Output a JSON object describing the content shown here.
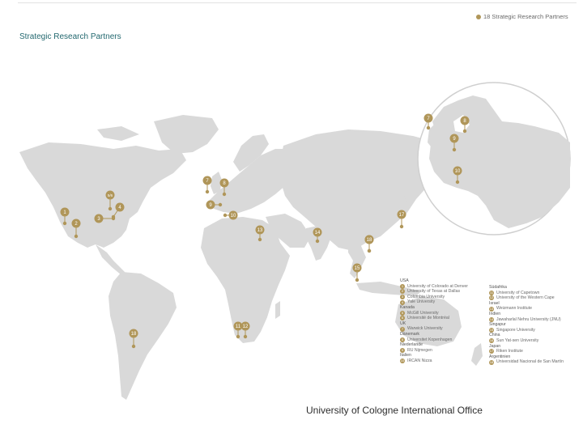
{
  "header": {
    "title": "Strategic Research Partners",
    "legend": "18 Strategic Research Partners"
  },
  "colors": {
    "land": "#d9d9d9",
    "marker": "#b09659",
    "title": "#23686f",
    "inset_border": "#cfcfcf"
  },
  "markers": [
    {
      "label": "1"
    },
    {
      "label": "2"
    },
    {
      "label": "3"
    },
    {
      "label": "4"
    },
    {
      "label": "5/6"
    },
    {
      "label": "7"
    },
    {
      "label": "8"
    },
    {
      "label": "9"
    },
    {
      "label": "10"
    },
    {
      "label": "11"
    },
    {
      "label": "12"
    },
    {
      "label": "13"
    },
    {
      "label": "14"
    },
    {
      "label": "15"
    },
    {
      "label": "16"
    },
    {
      "label": "17"
    },
    {
      "label": "18"
    },
    {
      "label": "18"
    },
    {
      "label": "7"
    },
    {
      "label": "8"
    },
    {
      "label": "9"
    },
    {
      "label": "10"
    }
  ],
  "partners_left": [
    {
      "country": "USA"
    },
    {
      "num": "1",
      "name": "University of Colorado at Denver"
    },
    {
      "num": "2",
      "name": "University of Texas at Dallas"
    },
    {
      "num": "3",
      "name": "Columbia University"
    },
    {
      "num": "4",
      "name": "Yale University"
    },
    {
      "country": "Kanada"
    },
    {
      "num": "5",
      "name": "McGill University"
    },
    {
      "num": "6",
      "name": "Université de Montréal"
    },
    {
      "country": "UK"
    },
    {
      "num": "7",
      "name": "Warwick University"
    },
    {
      "country": "Dänemark"
    },
    {
      "num": "8",
      "name": "Universitet Kopenhagen"
    },
    {
      "country": "Niederlande"
    },
    {
      "num": "9",
      "name": "RU Nijmegen"
    },
    {
      "country": "Italien"
    },
    {
      "num": "10",
      "name": "IRCAN Nizza"
    }
  ],
  "partners_right": [
    {
      "country": "Südafrika"
    },
    {
      "num": "11",
      "name": "University of Capetown"
    },
    {
      "num": "12",
      "name": "University of the Western Cape"
    },
    {
      "country": "Israel"
    },
    {
      "num": "13",
      "name": "Weizmann Institute"
    },
    {
      "country": "Indien"
    },
    {
      "num": "14",
      "name": "Jawaharlal Nehru University (JNU)"
    },
    {
      "country": "Singapur"
    },
    {
      "num": "15",
      "name": "Singapore University"
    },
    {
      "country": "China"
    },
    {
      "num": "16",
      "name": "Sun Yat-sen University"
    },
    {
      "country": "Japan"
    },
    {
      "num": "17",
      "name": "Riken Institute"
    },
    {
      "country": "Argentinien"
    },
    {
      "num": "18",
      "name": "Universidad Nacional de San Martín"
    }
  ],
  "footer": {
    "text": "University of Cologne International Office"
  }
}
